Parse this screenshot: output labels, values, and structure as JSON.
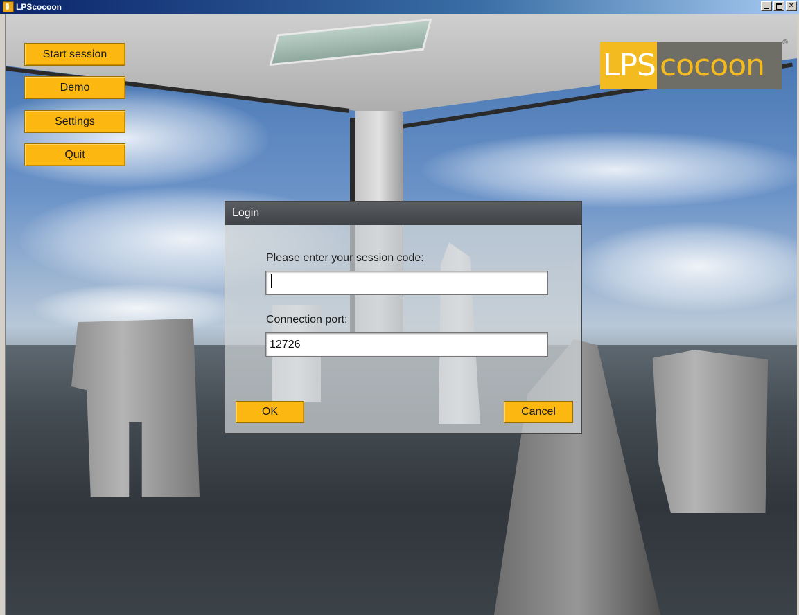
{
  "window": {
    "title": "LPScocoon",
    "controls": {
      "minimize_icon": "minimize-icon",
      "maximize_icon": "maximize-icon",
      "close_glyph": "✕"
    }
  },
  "menu": {
    "items": [
      {
        "label": "Start session"
      },
      {
        "label": "Demo"
      },
      {
        "label": "Settings"
      },
      {
        "label": "Quit"
      }
    ]
  },
  "logo": {
    "part1": "LPS",
    "part2": "cocoon",
    "registered": "®"
  },
  "dialog": {
    "title": "Login",
    "session_code": {
      "label": "Please enter your session code:",
      "value": ""
    },
    "port": {
      "label": "Connection port:",
      "value": "12726"
    },
    "ok_label": "OK",
    "cancel_label": "Cancel"
  },
  "colors": {
    "accent": "#fcb810",
    "dialog_title_bg": "#4a4d51",
    "logo_gray": "#6e6e66"
  }
}
